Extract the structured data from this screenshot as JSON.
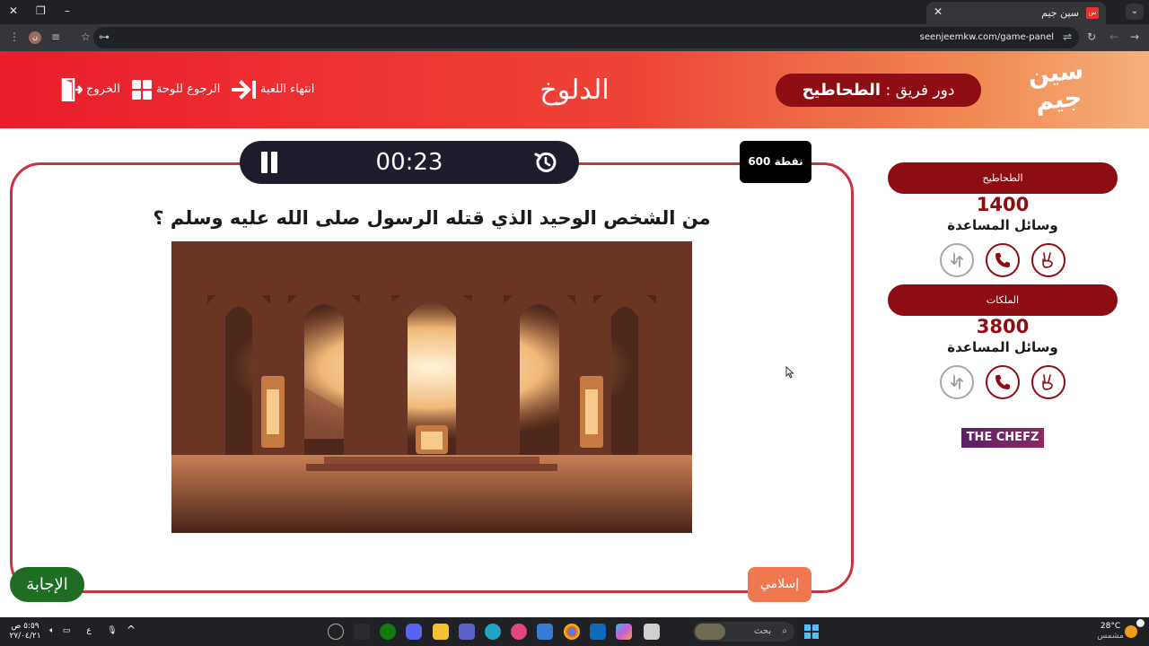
{
  "browser": {
    "tab_title": "سين جيم",
    "url": "seenjeemkw.com/game-panel"
  },
  "header": {
    "logo_text": "سين جيم",
    "turn_prefix": "دور فريق :",
    "turn_team": "الطحاطيح",
    "category_title": "الدلوخ",
    "end_game_label": "انتهاء اللعبة",
    "back_to_board_label": "الرجوع للوحة",
    "exit_label": "الخروج"
  },
  "question": {
    "timer": "00:23",
    "points": "600 نقطة",
    "text": "من الشخص الوحيد الذي قتله الرسول صلى الله عليه وسلم ؟",
    "category_tag": "إسلامي",
    "answer_button": "الإجابة"
  },
  "teams": [
    {
      "name": "الطحاطيح",
      "score": "1400",
      "aids_label": "وسائل المساعدة"
    },
    {
      "name": "الملكات",
      "score": "3800",
      "aids_label": "وسائل المساعدة"
    }
  ],
  "sponsor": {
    "text": "THE CHEFZ"
  },
  "taskbar": {
    "search_placeholder": "بحث",
    "weather_temp": "28°C",
    "weather_desc": "مشمس",
    "time": "٥:٥٩ ص",
    "date": "٢٧/٠٤/٢١",
    "lang": "ع"
  },
  "colors": {
    "brand_red": "#ea1d2c",
    "dark_red": "#8e0d12",
    "card_border": "#c9323f",
    "timer_bg": "#1d1d2d",
    "answer_green": "#1f6d22",
    "category_orange": "#f07850"
  }
}
